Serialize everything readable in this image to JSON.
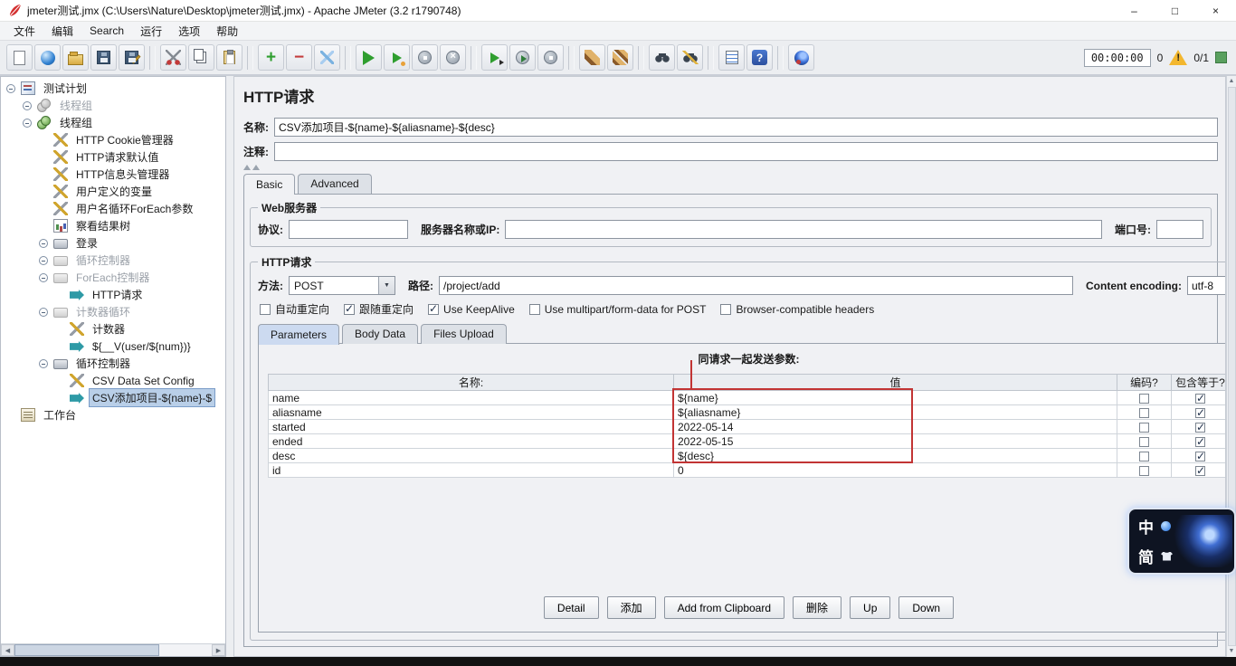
{
  "window": {
    "title": "jmeter测试.jmx (C:\\Users\\Nature\\Desktop\\jmeter测试.jmx) - Apache JMeter (3.2 r1790748)",
    "controls": {
      "minimize": "–",
      "maximize": "□",
      "close": "×"
    }
  },
  "menubar": {
    "items": [
      "文件",
      "编辑",
      "Search",
      "运行",
      "选项",
      "帮助"
    ]
  },
  "toolbar": {
    "icons": [
      "new-file",
      "templates",
      "open",
      "save",
      "save-as",
      "cut",
      "copy",
      "paste",
      "add",
      "remove",
      "toggle",
      "start",
      "start-no-timers",
      "stop",
      "shutdown",
      "remote-start",
      "remote-start-all",
      "remote-stop",
      "clear",
      "clear-all",
      "search",
      "search-reset",
      "function-helper",
      "help",
      "about"
    ],
    "timer": "00:00:00",
    "error_count": "0",
    "active_threads": "0/1"
  },
  "tree": {
    "items": [
      {
        "label": "测试计划",
        "icon": "test-plan"
      },
      {
        "label": "线程组",
        "icon": "thread-group",
        "disabled": true
      },
      {
        "label": "线程组",
        "icon": "thread-group"
      },
      {
        "label": "HTTP Cookie管理器",
        "icon": "config-element"
      },
      {
        "label": "HTTP请求默认值",
        "icon": "config-element"
      },
      {
        "label": "HTTP信息头管理器",
        "icon": "config-element"
      },
      {
        "label": "用户定义的变量",
        "icon": "config-element"
      },
      {
        "label": "用户名循环ForEach参数",
        "icon": "config-element"
      },
      {
        "label": "察看结果树",
        "icon": "listener"
      },
      {
        "label": "登录",
        "icon": "controller"
      },
      {
        "label": "循环控制器",
        "icon": "controller",
        "disabled": true
      },
      {
        "label": "ForEach控制器",
        "icon": "controller",
        "disabled": true
      },
      {
        "label": "HTTP请求",
        "icon": "sampler"
      },
      {
        "label": "计数器循环",
        "icon": "controller",
        "disabled": true
      },
      {
        "label": "计数器",
        "icon": "config-element"
      },
      {
        "label": "${__V(user/${num})}",
        "icon": "sampler"
      },
      {
        "label": "循环控制器",
        "icon": "controller"
      },
      {
        "label": "CSV Data Set Config",
        "icon": "config-element"
      },
      {
        "label": "CSV添加项目-${name}-$",
        "icon": "sampler",
        "selected": true
      },
      {
        "label": "工作台",
        "icon": "workbench"
      }
    ]
  },
  "main": {
    "title": "HTTP请求",
    "name": {
      "label": "名称:",
      "value": "CSV添加项目-${name}-${aliasname}-${desc}"
    },
    "comment": {
      "label": "注释:",
      "value": ""
    },
    "tabs": [
      "Basic",
      "Advanced"
    ],
    "web_server": {
      "legend": "Web服务器",
      "protocol_label": "协议:",
      "protocol_value": "",
      "server_label": "服务器名称或IP:",
      "server_value": "",
      "port_label": "端口号:",
      "port_value": ""
    },
    "http_request": {
      "legend": "HTTP请求",
      "method_label": "方法:",
      "method_value": "POST",
      "path_label": "路径:",
      "path_value": "/project/add",
      "encoding_label": "Content encoding:",
      "encoding_value": "utf-8",
      "checkboxes": [
        {
          "label": "自动重定向",
          "checked": false
        },
        {
          "label": "跟随重定向",
          "checked": true
        },
        {
          "label": "Use KeepAlive",
          "checked": true
        },
        {
          "label": "Use multipart/form-data for POST",
          "checked": false
        },
        {
          "label": "Browser-compatible headers",
          "checked": false
        }
      ]
    },
    "param_tabs": [
      "Parameters",
      "Body Data",
      "Files Upload"
    ],
    "parameters": {
      "title": "同请求一起发送参数:",
      "columns": [
        "名称:",
        "值",
        "编码?",
        "包含等于?"
      ],
      "rows": [
        {
          "name": "name",
          "value": "${name}",
          "encode": false,
          "include_equals": true
        },
        {
          "name": "aliasname",
          "value": "${aliasname}",
          "encode": false,
          "include_equals": true
        },
        {
          "name": "started",
          "value": "2022-05-14",
          "encode": false,
          "include_equals": true
        },
        {
          "name": "ended",
          "value": "2022-05-15",
          "encode": false,
          "include_equals": true
        },
        {
          "name": "desc",
          "value": "${desc}",
          "encode": false,
          "include_equals": true
        },
        {
          "name": "id",
          "value": "0",
          "encode": false,
          "include_equals": true
        }
      ],
      "buttons": [
        "Detail",
        "添加",
        "Add from Clipboard",
        "删除",
        "Up",
        "Down"
      ]
    }
  },
  "ime": {
    "lang": "中",
    "mode": "简"
  },
  "colors": {
    "selection": "#b9cfe8",
    "annotation": "#c23434",
    "start_green": "#2f9e2f",
    "warning_yellow": "#f3b72e"
  }
}
